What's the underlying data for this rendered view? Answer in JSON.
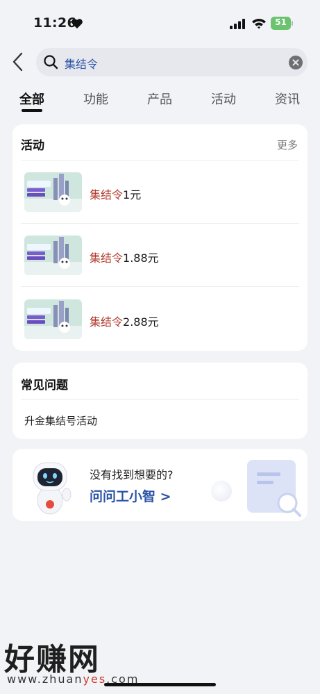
{
  "status_bar": {
    "time": "11:26",
    "battery": "51"
  },
  "search": {
    "query": "集结令"
  },
  "tabs": [
    {
      "label": "全部",
      "active": true
    },
    {
      "label": "功能"
    },
    {
      "label": "产品"
    },
    {
      "label": "活动"
    },
    {
      "label": "资讯"
    }
  ],
  "activities": {
    "title": "活动",
    "more": "更多",
    "items": [
      {
        "highlight": "集结令",
        "rest": "1元"
      },
      {
        "highlight": "集结令",
        "rest": "1.88元"
      },
      {
        "highlight": "集结令",
        "rest": "2.88元"
      }
    ]
  },
  "faq": {
    "title": "常见问题",
    "items": [
      "升金集结号活动"
    ]
  },
  "assistant": {
    "question": "没有找到想要的?",
    "action": "问问工小智 >"
  },
  "watermark": {
    "brand": "好赚网",
    "url_prefix": "www.zhuan",
    "url_accent": "yes",
    "url_suffix": ".com"
  },
  "colors": {
    "accent_blue": "#2c53a6",
    "highlight_red": "#b23a2e",
    "battery_green": "#6cc36f"
  }
}
